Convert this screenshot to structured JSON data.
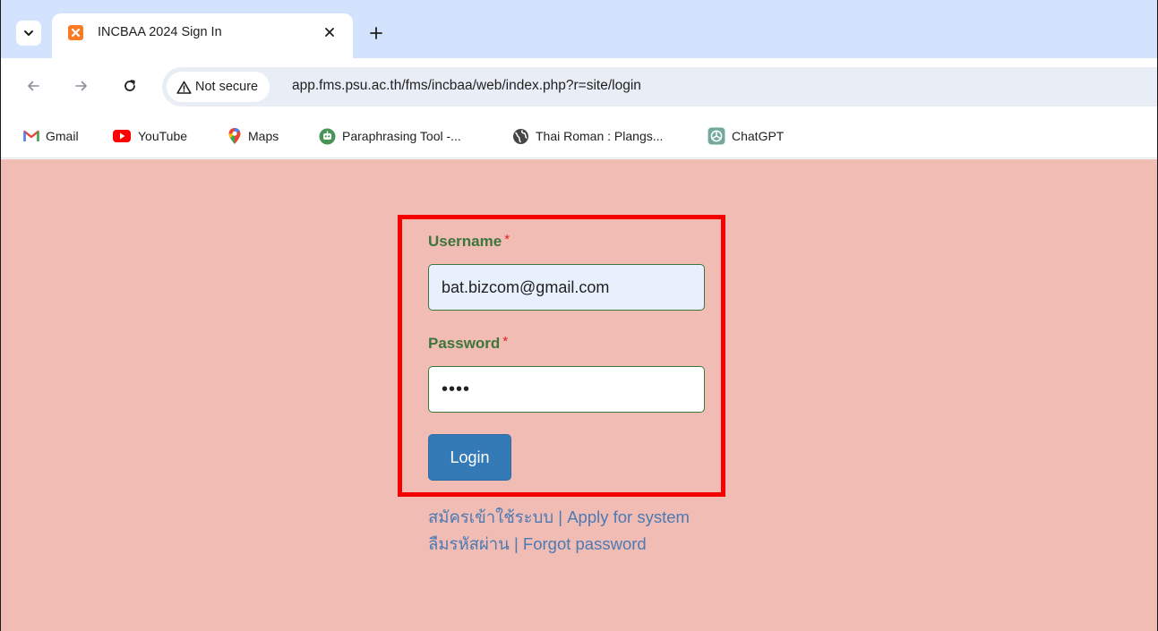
{
  "browser": {
    "tab": {
      "title": "INCBAA 2024 Sign In"
    },
    "omnibox": {
      "security_label": "Not secure",
      "url": "app.fms.psu.ac.th/fms/incbaa/web/index.php?r=site/login"
    },
    "bookmarks": [
      {
        "label": "Gmail",
        "icon": "gmail-icon"
      },
      {
        "label": "YouTube",
        "icon": "youtube-icon"
      },
      {
        "label": "Maps",
        "icon": "maps-icon"
      },
      {
        "label": "Paraphrasing Tool -...",
        "icon": "paraphrasing-tool-icon"
      },
      {
        "label": "Thai Roman : Plangs...",
        "icon": "globe-icon"
      },
      {
        "label": "ChatGPT",
        "icon": "chatgpt-icon"
      }
    ]
  },
  "login_form": {
    "username_label": "Username",
    "username_value": "bat.bizcom@gmail.com",
    "password_label": "Password",
    "password_value": "••••",
    "required_marker": "*",
    "login_button": "Login",
    "apply_link": "สมัครเข้าใช้ระบบ | Apply for system",
    "forgot_link": "ลืมรหัสผ่าน | Forgot password"
  },
  "colors": {
    "page_background": "#f0bcb4",
    "highlight_border": "#f40000",
    "label_green": "#3c763d",
    "button_blue": "#337ab7",
    "link_blue": "#4b7ab5"
  }
}
